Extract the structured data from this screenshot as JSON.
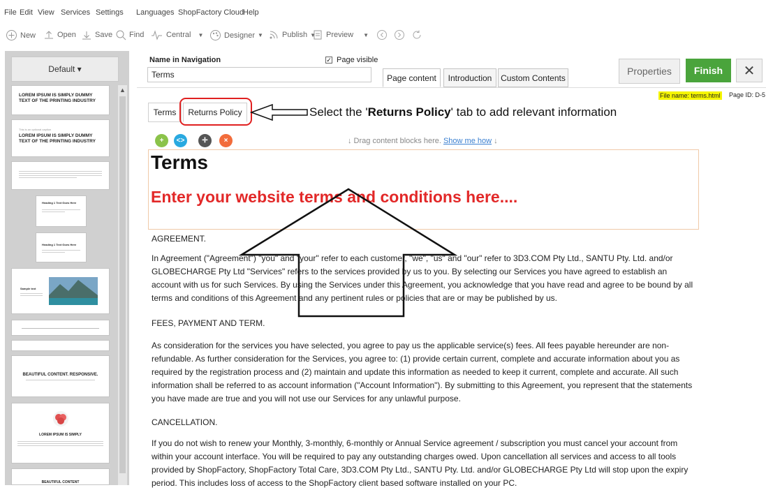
{
  "menu": [
    "File",
    "Edit",
    "View",
    "Services",
    "Settings",
    "Languages",
    "ShopFactory Cloud",
    "Help"
  ],
  "toolbar": {
    "new": "New",
    "open": "Open",
    "save": "Save",
    "find": "Find",
    "central": "Central",
    "designer": "Designer",
    "publish": "Publish",
    "preview": "Preview"
  },
  "sidebar": {
    "default_label": "Default ▾",
    "thumbs": [
      {
        "title": "LOREM IPSUM IS SIMPLY DUMMY TEXT OF THE PRINTING INDUSTRY"
      },
      {
        "kicker": "This is an optional caption",
        "title": "LOREM IPSUM IS SIMPLY DUMMY TEXT OF THE PRINTING INDUSTRY"
      },
      {
        "title": ""
      },
      {
        "title": "Heading 1 Text Goes Here"
      },
      {
        "title": "Heading 1 Text Goes Here"
      },
      {
        "title": "Sample text"
      },
      {
        "title": ""
      },
      {
        "title": ""
      },
      {
        "title": "BEAUTIFUL CONTENT. RESPONSIVE."
      },
      {
        "title": "LOREM IPSUM IS SIMPLY"
      },
      {
        "title": "BEAUTIFUL CONTENT"
      }
    ]
  },
  "header": {
    "name_label": "Name in Navigation",
    "name_value": "Terms",
    "page_visible_label": "Page visible",
    "tabs": [
      "Page content",
      "Introduction",
      "Custom Contents"
    ],
    "properties": "Properties",
    "finish": "Finish",
    "close": "✕",
    "file_name": "File name: terms.html",
    "page_id": "Page ID: D-5"
  },
  "editor": {
    "tabs": [
      "Terms",
      "Returns Policy"
    ],
    "annotation_pre": "Select the '",
    "annotation_bold": "Returns Policy",
    "annotation_post": "' tab to add relevant information",
    "drag_hint": "↓  Drag content blocks here.",
    "show_me_how": "Show me how",
    "drag_hint_end": " ↓",
    "heading": "Terms",
    "red_text": "Enter your website terms and conditions here....",
    "paragraphs": [
      "AGREEMENT.",
      "In Agreement (\"Agreement\") \"you\" and \"your\" refer to each customer, \"we\", \"us\" and \"our\" refer to 3D3.COM Pty Ltd., SANTU Pty. Ltd. and/or GLOBECHARGE Pty Ltd \"Services\" refers to the services provided by us to you. By selecting our Services you have agreed to establish an account with us for such Services. By using the Services under this Agreement, you acknowledge that you have read and agree to be bound by all terms and conditions of this Agreement and any pertinent rules or policies that are or may be published by us.",
      "FEES, PAYMENT AND TERM.",
      "As consideration for the services you have selected, you agree to pay us the applicable service(s) fees. All fees payable hereunder are non-refundable. As further consideration for the Services, you agree to: (1) provide certain current, complete and accurate information about you as required by the registration process and (2) maintain and update this information as needed to keep it current, complete and accurate. All such information shall be referred to as account information (\"Account Information\"). By submitting to this Agreement, you represent that the statements you have made are true and you will not use our Services for any unlawful purpose.",
      "CANCELLATION.",
      "If you do not wish to renew your Monthly, 3-monthly, 6-monthly or Annual Service agreement / subscription you must cancel your account from within your account interface. You will be required to pay any outstanding charges owed. Upon cancellation all services and access to all tools provided by ShopFactory, ShopFactory Total Care, 3D3.COM Pty Ltd., SANTU Pty. Ltd. and/or GLOBECHARGE Pty Ltd will stop upon the expiry period. This includes loss of access to the ShopFactory client based software installed on your PC."
    ]
  }
}
